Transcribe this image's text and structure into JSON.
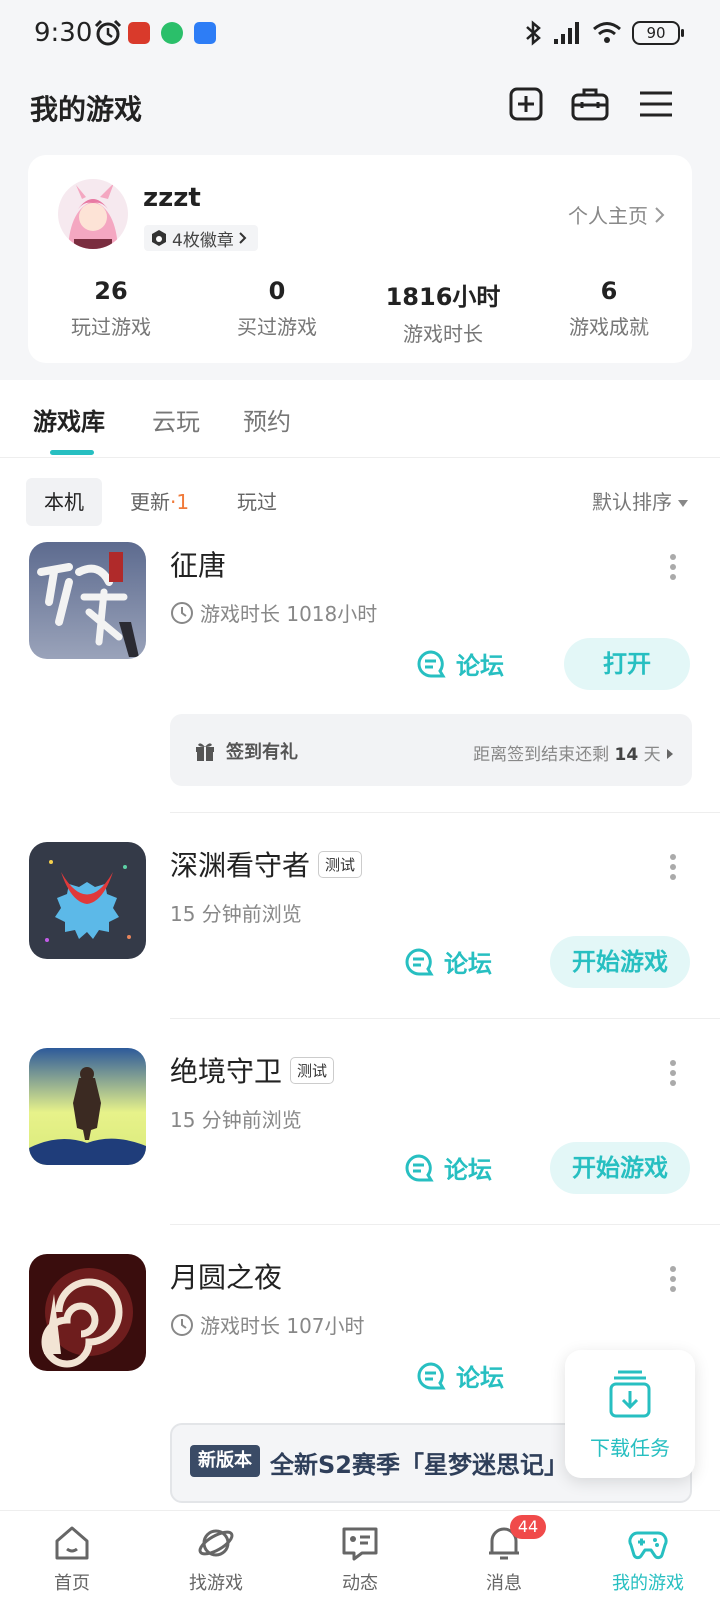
{
  "status_bar": {
    "time": "9:30",
    "battery": "90"
  },
  "header": {
    "title": "我的游戏"
  },
  "profile": {
    "username": "zzzt",
    "badge_label": "4枚徽章",
    "homepage_label": "个人主页",
    "stats": [
      {
        "value": "26",
        "label": "玩过游戏"
      },
      {
        "value": "0",
        "label": "买过游戏"
      },
      {
        "value": "1816小时",
        "label": "游戏时长"
      },
      {
        "value": "6",
        "label": "游戏成就"
      }
    ]
  },
  "tabs": [
    {
      "label": "游戏库"
    },
    {
      "label": "云玩"
    },
    {
      "label": "预约"
    }
  ],
  "filters": {
    "local": "本机",
    "update": "更新",
    "update_count": "1",
    "played": "玩过",
    "sort": "默认排序"
  },
  "games": [
    {
      "name": "征唐",
      "tag": "",
      "subtitle": "游戏时长 1018小时",
      "forum": "论坛",
      "action": "打开"
    },
    {
      "name": "深渊看守者",
      "tag": "测试",
      "subtitle": "15 分钟前浏览",
      "forum": "论坛",
      "action": "开始游戏"
    },
    {
      "name": "绝境守卫",
      "tag": "测试",
      "subtitle": "15 分钟前浏览",
      "forum": "论坛",
      "action": "开始游戏"
    },
    {
      "name": "月圆之夜",
      "tag": "",
      "subtitle": "游戏时长 107小时",
      "forum": "论坛",
      "action": ""
    }
  ],
  "signin": {
    "label": "签到有礼",
    "remaining_prefix": "距离签到结束还剩",
    "remaining_days": "14",
    "remaining_unit": "天"
  },
  "banner": {
    "new_label": "新版本",
    "text": "全新S2赛季「星梦迷思记」"
  },
  "download_task": {
    "label": "下载任务"
  },
  "bottom_nav": [
    {
      "label": "首页"
    },
    {
      "label": "找游戏"
    },
    {
      "label": "动态"
    },
    {
      "label": "消息",
      "badge": "44"
    },
    {
      "label": "我的游戏"
    }
  ],
  "colors": {
    "accent": "#27bfc1",
    "badge_red": "#f04a4a",
    "update_orange": "#f07a3a"
  }
}
